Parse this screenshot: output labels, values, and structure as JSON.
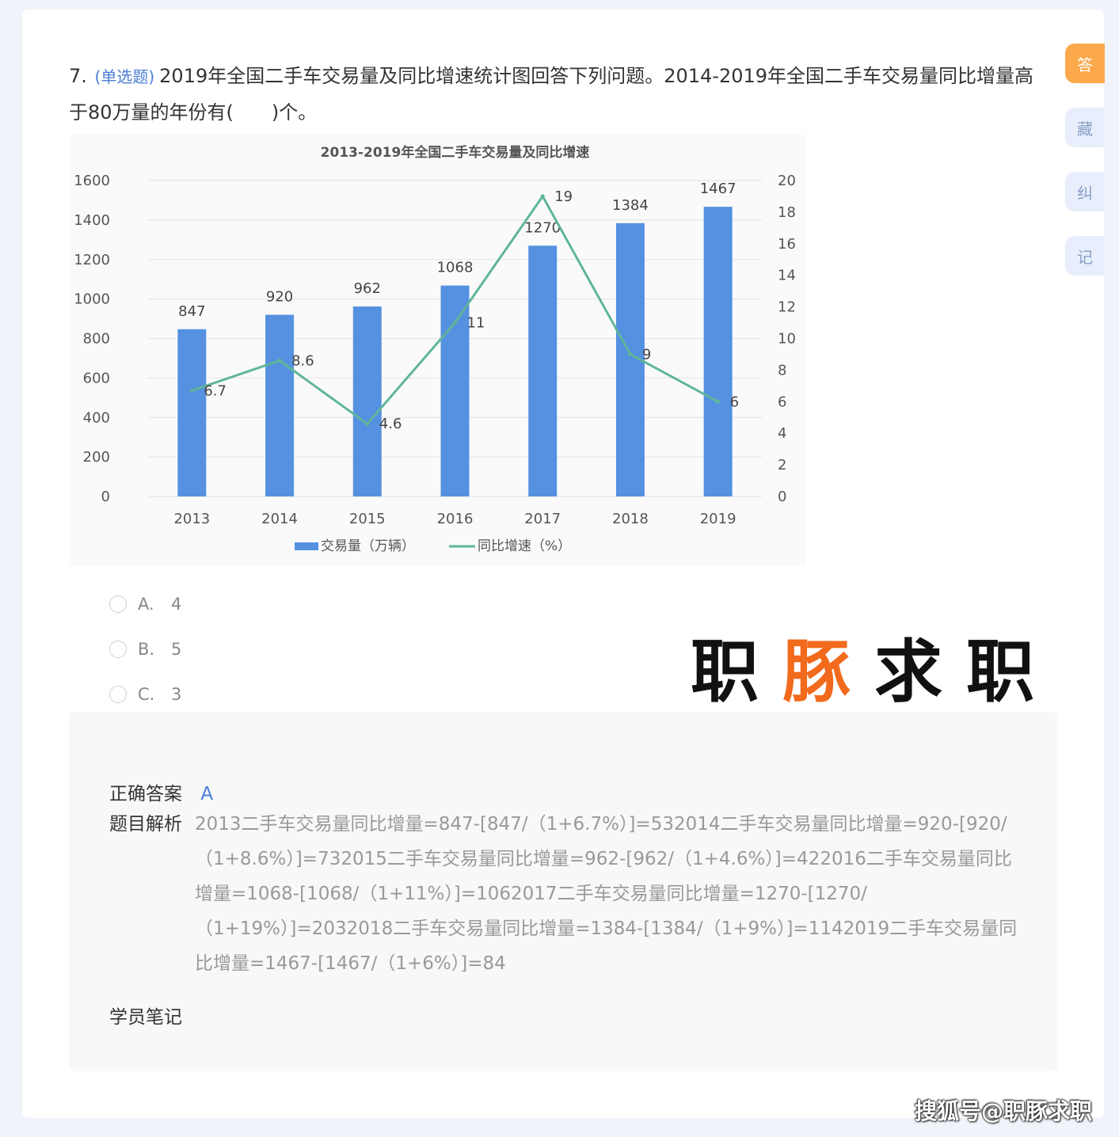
{
  "question": {
    "number": "7.",
    "type": "(单选题)",
    "text": "2019年全国二手车交易量及同比增速统计图回答下列问题。2014-2019年全国二手车交易量同比增量高于80万量的年份有(　　)个。"
  },
  "options": [
    {
      "letter": "A.",
      "value": "4"
    },
    {
      "letter": "B.",
      "value": "5"
    },
    {
      "letter": "C.",
      "value": "3"
    }
  ],
  "watermark": {
    "part1": "职",
    "part2": "豚",
    "part3": "求职"
  },
  "answer": {
    "correct_label": "正确答案",
    "correct_value": "A",
    "analysis_label": "题目解析",
    "analysis_text": "2013二手车交易量同比增量=847-[847/（1+6.7%）]=532014二手车交易量同比增量=920-[920/（1+8.6%）]=732015二手车交易量同比增量=962-[962/（1+4.6%）]=422016二手车交易量同比增量=1068-[1068/（1+11%）]=1062017二手车交易量同比增量=1270-[1270/（1+19%）]=2032018二手车交易量同比增量=1384-[1384/（1+9%）]=1142019二手车交易量同比增量=1467-[1467/（1+6%）]=84",
    "notes_label": "学员笔记"
  },
  "side_tabs": [
    "答",
    "藏",
    "纠",
    "记"
  ],
  "footer_watermark": "搜狐号@职豚求职",
  "colors": {
    "bar": "#5591e0",
    "line": "#5fb59a",
    "accent_tab": "#fba94a",
    "brand_orange": "#f26a1c"
  },
  "chart_data": {
    "type": "bar",
    "title": "2013-2019年全国二手车交易量及同比增速",
    "categories": [
      "2013",
      "2014",
      "2015",
      "2016",
      "2017",
      "2018",
      "2019"
    ],
    "series": [
      {
        "name": "交易量（万辆）",
        "type": "bar",
        "axis": "left",
        "values": [
          847,
          920,
          962,
          1068,
          1270,
          1384,
          1467
        ]
      },
      {
        "name": "同比增速（%）",
        "type": "line",
        "axis": "right",
        "values": [
          6.7,
          8.6,
          4.6,
          11,
          19,
          9,
          6
        ]
      }
    ],
    "ylim_left": [
      0,
      1600
    ],
    "yticks_left": [
      0,
      200,
      400,
      600,
      800,
      1000,
      1200,
      1400,
      1600
    ],
    "ylim_right": [
      0,
      20
    ],
    "yticks_right": [
      0,
      2,
      4,
      6,
      8,
      10,
      12,
      14,
      16,
      18,
      20
    ],
    "grid": true,
    "legend": "bottom"
  }
}
